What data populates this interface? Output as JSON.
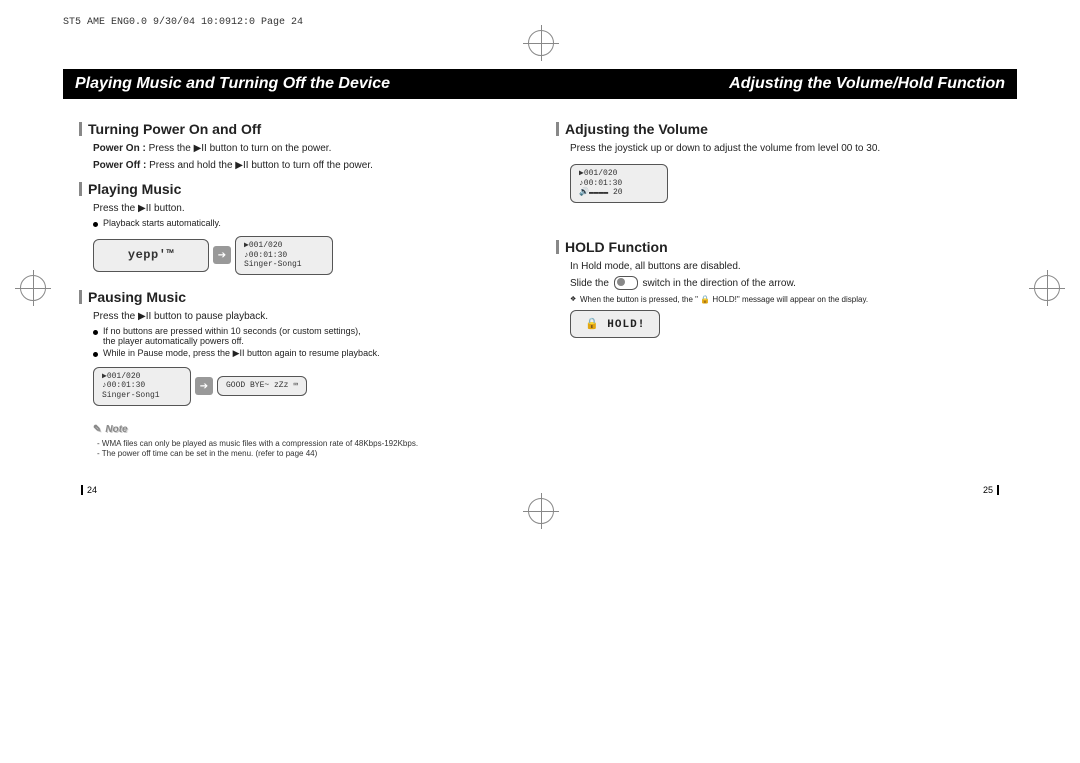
{
  "header_line": "ST5 AME ENG0.0  9/30/04 10:0912:0  Page 24",
  "bar": {
    "left_title": "Playing Music and Turning Off the Device",
    "right_title": "Adjusting the Volume/Hold Function"
  },
  "left": {
    "s1_title": "Turning Power On and Off",
    "s1_l1a": "Power On :  ",
    "s1_l1b": "Press the ▶II  button to turn on the power.",
    "s1_l2a": "Power Off :  ",
    "s1_l2b": "Press and hold the ▶II  button to turn off the power.",
    "s2_title": "Playing Music",
    "s2_l1": "Press the ▶II button.",
    "s2_b1": "Playback starts automatically.",
    "lcd_logo": "yepp'™",
    "lcd_small_l1": "▶001/020",
    "lcd_small_l2": "♪00:01:30",
    "lcd_small_l3": "Singer-Song1",
    "s3_title": "Pausing Music",
    "s3_l1": "Press the ▶II  button to pause playback.",
    "s3_b1": "If no buttons are pressed within 10 seconds (or custom settings),",
    "s3_b1b": "the player automatically powers off.",
    "s3_b2": "While in Pause mode, press the ▶II button again to resume playback.",
    "lcd2_l1": "▶001/020",
    "lcd2_l2": "♪00:01:30",
    "lcd2_l3": "Singer-Song1",
    "lcd2_bye": "GOOD BYE~ zZz ⌨",
    "note_title": "Note",
    "note_l1": "- WMA files can only be played as music files with a compression rate of 48Kbps-192Kbps.",
    "note_l2": "- The power off time can be set in the menu. (refer to page 44)",
    "page_num": "24"
  },
  "right": {
    "s1_title": "Adjusting the Volume",
    "s1_l1": "Press the joystick up or down to adjust the volume from level 00 to 30.",
    "lcd_l1": "▶001/020",
    "lcd_l2": "♪00:01:30",
    "lcd_l3": "🔊▬▬▬▬  20",
    "s2_title": "HOLD Function",
    "s2_l1": "In Hold mode, all buttons are disabled.",
    "s2_l2a": "Slide the",
    "s2_l2b": "switch in the direction of the arrow.",
    "s2_note": "When the button is pressed, the \" 🔒 HOLD!\" message will appear on the display.",
    "hold_label": "🔒 HOLD!",
    "page_num": "25"
  }
}
